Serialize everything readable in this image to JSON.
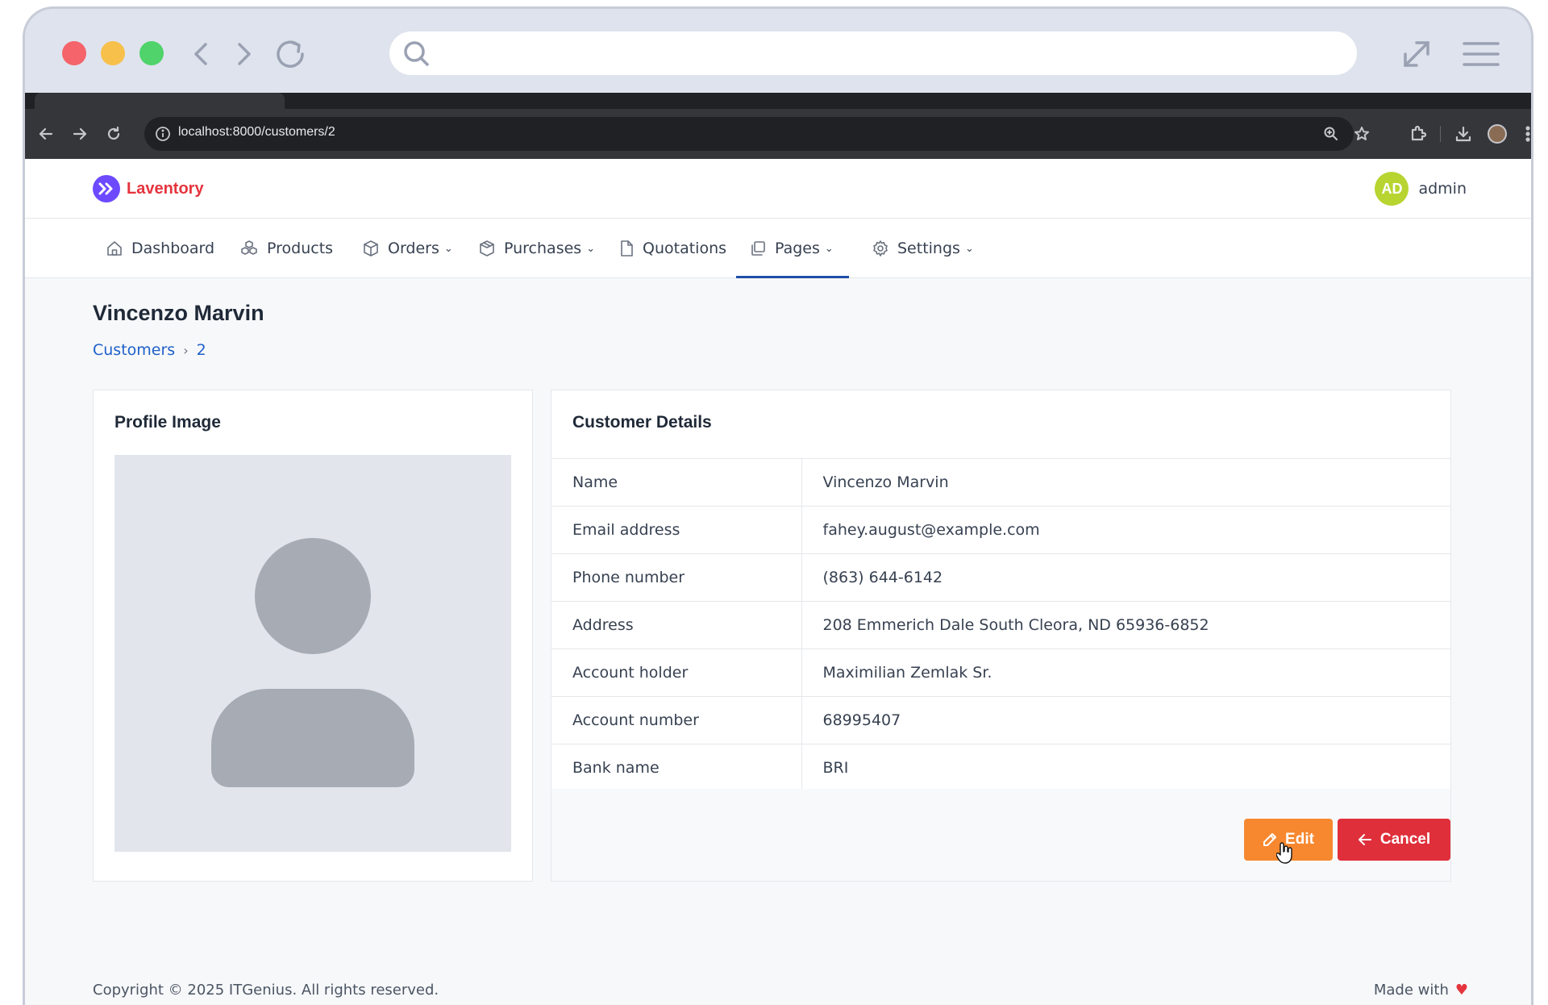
{
  "browser": {
    "url": "localhost:8000/customers/2"
  },
  "app": {
    "brand": "Laventory",
    "brand_color": "#e5343d",
    "user": {
      "initials": "AD",
      "name": "admin"
    }
  },
  "nav": {
    "items": [
      {
        "label": "Dashboard",
        "icon": "home-icon",
        "dropdown": false
      },
      {
        "label": "Products",
        "icon": "cubes-icon",
        "dropdown": false
      },
      {
        "label": "Orders",
        "icon": "package-icon",
        "dropdown": true
      },
      {
        "label": "Purchases",
        "icon": "box-icon",
        "dropdown": true
      },
      {
        "label": "Quotations",
        "icon": "document-icon",
        "dropdown": false
      },
      {
        "label": "Pages",
        "icon": "copy-icon",
        "dropdown": true,
        "active": true
      },
      {
        "label": "Settings",
        "icon": "gear-icon",
        "dropdown": true
      }
    ],
    "chevron": "⌄"
  },
  "page": {
    "title": "Vincenzo Marvin",
    "breadcrumb": {
      "parent": "Customers",
      "separator": "›",
      "current": "2"
    }
  },
  "profile_card": {
    "title": "Profile Image"
  },
  "details_card": {
    "title": "Customer Details",
    "rows": [
      {
        "label": "Name",
        "value": "Vincenzo Marvin"
      },
      {
        "label": "Email address",
        "value": "fahey.august@example.com"
      },
      {
        "label": "Phone number",
        "value": "(863) 644-6142"
      },
      {
        "label": "Address",
        "value": "208 Emmerich Dale South Cleora, ND 65936-6852"
      },
      {
        "label": "Account holder",
        "value": "Maximilian Zemlak Sr."
      },
      {
        "label": "Account number",
        "value": "68995407"
      },
      {
        "label": "Bank name",
        "value": "BRI"
      }
    ],
    "actions": {
      "edit_label": "Edit",
      "cancel_label": "Cancel"
    }
  },
  "footer": {
    "copyright": "Copyright © 2025 ITGenius. All rights reserved.",
    "made_with": "Made with"
  },
  "colors": {
    "edit_button": "#f7882f",
    "cancel_button": "#df2f3a",
    "link": "#1e60c9",
    "active_nav": "#1e4ea8"
  }
}
